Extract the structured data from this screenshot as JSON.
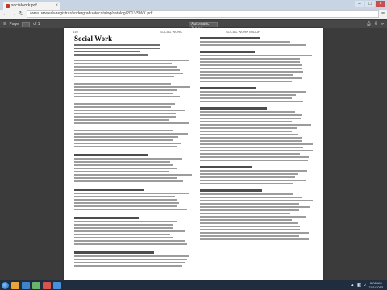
{
  "browser": {
    "tab_title": "socialwork.pdf",
    "tab_close": "×",
    "window_controls": {
      "minimize": "–",
      "maximize": "□",
      "close": "×"
    },
    "nav": {
      "back": "←",
      "forward": "→",
      "reload": "↻",
      "menu": "≡"
    },
    "url": "www.uww.edu/registrar/undergraduatecatalog/catalog/2013/SWK.pdf"
  },
  "pdf_toolbar": {
    "sidebar_icon": "≡",
    "page_label": "Page",
    "page_total": "of 1",
    "zoom": "Automatic Zoom",
    "print_icon": "⎙",
    "download_icon": "⇩",
    "more_icon": "»"
  },
  "document": {
    "running_head": {
      "left": "410",
      "middle": "SOCIAL WORK",
      "right": "SOCIAL WORK MAJOR"
    },
    "title": "Social Work"
  },
  "taskbar": {
    "tray_icons": [
      "▲",
      "◧",
      "♪"
    ],
    "time": "9:08 AM",
    "date": "7/11/2013",
    "task_icon_colors": [
      "#e8a53a",
      "#3f83c9",
      "#6bb36b",
      "#d9534f",
      "#4a90d9"
    ]
  },
  "colors": {
    "page": "#ffffff",
    "viewer_bg": "#3b3b3b",
    "toolbar": "#474747",
    "taskbar": "#1f2d3f"
  }
}
